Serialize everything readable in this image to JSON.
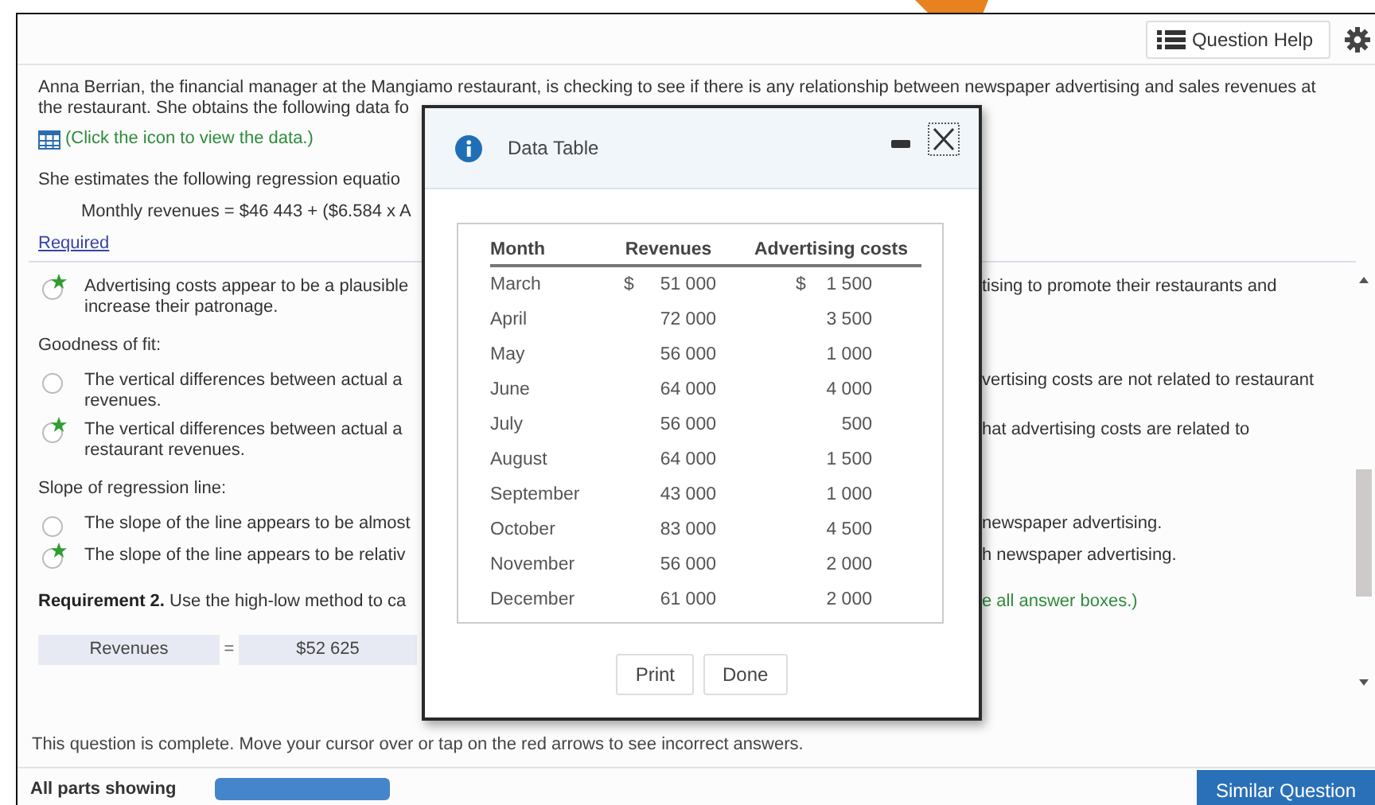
{
  "header": {
    "help_button": "Question Help"
  },
  "intro": {
    "paragraph": [
      "Anna Berrian, the financial manager at the Mangiamo restaurant, is checking to see if there is any relationship between newspaper advertising and sales revenues at",
      "the restaurant. She obtains the following data fo"
    ],
    "data_link": "(Click the icon to view the data.)",
    "equation_intro": "She estimates the following regression equatio",
    "equation": "Monthly revenues = $46 443 + ($6.584 x A",
    "required_link": "Required"
  },
  "answers": [
    {
      "kind": "option",
      "selected": true,
      "left": [
        "Advertising costs appear to be a plausible",
        "increase their patronage."
      ],
      "right": "tising to promote their restaurants and"
    },
    {
      "kind": "heading",
      "text": "Goodness of fit:"
    },
    {
      "kind": "option",
      "selected": false,
      "left": [
        "The vertical differences between actual a",
        "revenues."
      ],
      "right": "vertising costs are not related to restaurant"
    },
    {
      "kind": "option",
      "selected": true,
      "left": [
        "The vertical differences between actual a",
        "restaurant revenues."
      ],
      "right": "hat advertising costs are related to"
    },
    {
      "kind": "heading",
      "text": "Slope of regression line:"
    },
    {
      "kind": "option",
      "selected": false,
      "left": [
        "The slope of the line appears to be almost"
      ],
      "right": "newspaper advertising."
    },
    {
      "kind": "option",
      "selected": true,
      "left": [
        "The slope of the line appears to be relativ"
      ],
      "right": "h newspaper advertising."
    },
    {
      "kind": "requirement",
      "text": "**Requirement 2.** Use the high-low method to ca",
      "right": "e all answer boxes.)"
    },
    {
      "kind": "inputs",
      "label": "Revenues",
      "operator": "=",
      "value": "$52 625"
    }
  ],
  "status_message": "This question is complete. Move your cursor over or tap on the red arrows to see incorrect answers.",
  "bottom_bar": {
    "label": "All parts showing",
    "progress": {
      "level": 1
    },
    "button": "Similar Question"
  },
  "data_table": {
    "title": "Data Table",
    "columns": [
      "Month",
      "Revenues",
      "Advertising costs"
    ],
    "rows": [
      {
        "month": "March",
        "revenues": {
          "unit": "$",
          "value": "51 000"
        },
        "advertising": {
          "unit": "$",
          "value": "1 500"
        }
      },
      {
        "month": "April",
        "revenues": {
          "value": "72 000"
        },
        "advertising": {
          "value": "3 500"
        }
      },
      {
        "month": "May",
        "revenues": {
          "value": "56 000"
        },
        "advertising": {
          "value": "1 000"
        }
      },
      {
        "month": "June",
        "revenues": {
          "value": "64 000"
        },
        "advertising": {
          "value": "4 000"
        }
      },
      {
        "month": "July",
        "revenues": {
          "value": "56 000"
        },
        "advertising": {
          "value": "500"
        }
      },
      {
        "month": "August",
        "revenues": {
          "value": "64 000"
        },
        "advertising": {
          "value": "1 500"
        }
      },
      {
        "month": "September",
        "revenues": {
          "value": "43 000"
        },
        "advertising": {
          "value": "1 000"
        }
      },
      {
        "month": "October",
        "revenues": {
          "value": "83 000"
        },
        "advertising": {
          "value": "4 500"
        }
      },
      {
        "month": "November",
        "revenues": {
          "value": "56 000"
        },
        "advertising": {
          "value": "2 000"
        }
      },
      {
        "month": "December",
        "revenues": {
          "value": "61 000"
        },
        "advertising": {
          "value": "2 000"
        }
      }
    ],
    "buttons": [
      "Print",
      "Done"
    ]
  }
}
